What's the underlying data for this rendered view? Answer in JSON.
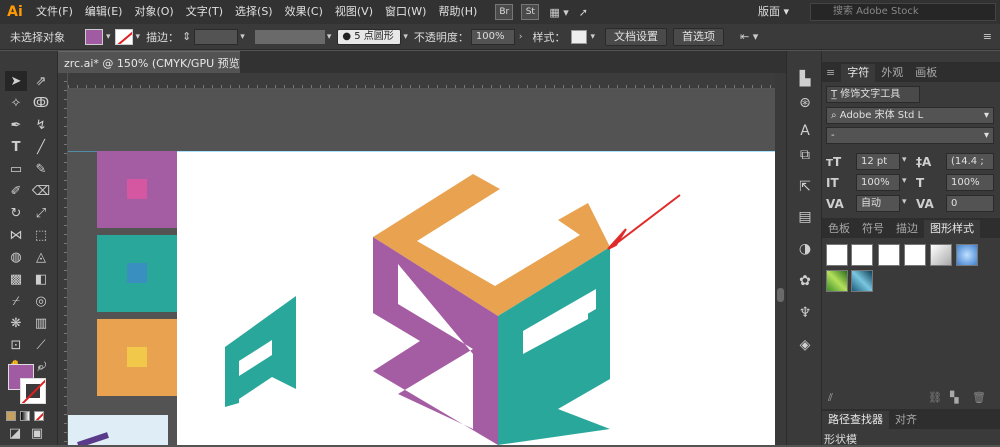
{
  "app": {
    "logo": "Ai"
  },
  "menu": [
    "文件(F)",
    "编辑(E)",
    "对象(O)",
    "文字(T)",
    "选择(S)",
    "效果(C)",
    "视图(V)",
    "窗口(W)",
    "帮助(H)"
  ],
  "app_switcher": [
    "Br",
    "St"
  ],
  "workspace": {
    "label": "版面"
  },
  "search": {
    "placeholder": "搜索 Adobe Stock"
  },
  "control": {
    "selection": "未选择对象",
    "stroke_label": "描边：",
    "brush": "5 点圆形",
    "opacity_label": "不透明度：",
    "opacity": "100%",
    "style_label": "样式：",
    "doc_setup": "文档设置",
    "preferences": "首选项",
    "fill_color": "#a05ba2"
  },
  "document": {
    "tab_title": "zrc.ai* @ 150% (CMYK/GPU 预览)",
    "close": "×"
  },
  "artwork": {
    "swatches": [
      {
        "outer": "#a45ca3",
        "inner": "#d557a2"
      },
      {
        "outer": "#2aa79b",
        "inner": "#3a8fc1"
      },
      {
        "outer": "#e9a24f",
        "inner": "#f2c84a"
      }
    ],
    "colors": {
      "purple": "#a45ca3",
      "teal": "#2aa79b",
      "orange": "#e9a24f",
      "arrow": "#e02b2b"
    }
  },
  "panels": {
    "char_tabs": [
      "字符",
      "外观",
      "画板"
    ],
    "touch_type": "修饰文字工具",
    "font_family": "Adobe 宋体 Std L",
    "font_style": "-",
    "font_size": "12 pt",
    "leading": "(14.4 ;",
    "vscale": "100%",
    "hscale": "100%",
    "kerning": "自动",
    "tracking": "0",
    "style_tabs": [
      "色板",
      "符号",
      "描边",
      "图形样式"
    ],
    "bottom_tabs": [
      "路径查找器",
      "对齐"
    ],
    "shape_mode": "形状模"
  }
}
